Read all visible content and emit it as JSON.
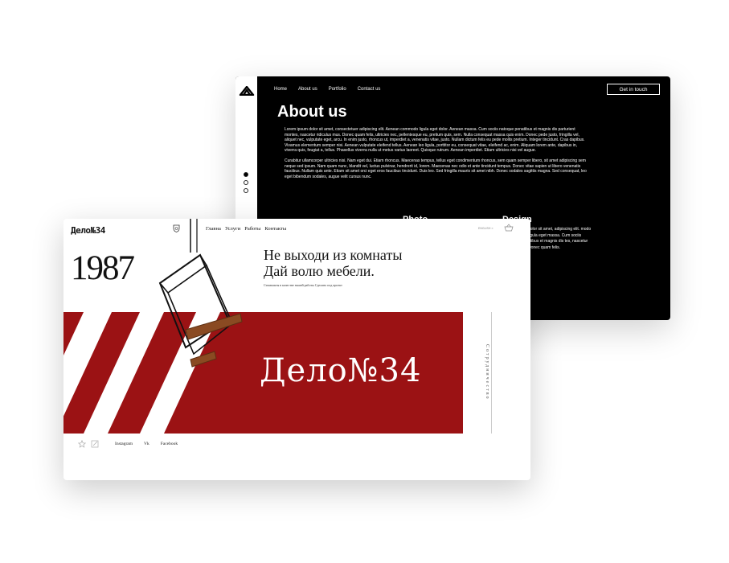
{
  "back_site": {
    "nav": [
      "Home",
      "About us",
      "Portfolio",
      "Contact us"
    ],
    "cta": "Get in touch",
    "title": "About us",
    "paragraphs": [
      "Lorem ipsum dolor sit amet, consectetuer adipiscing elit. Aenean commodo ligula eget dolor. Aenean massa. Cum sociis natoque penatibus et magnis dis parturient montes, nascetur ridiculus mus. Donec quam felis, ultricies nec, pellentesque eu, pretium quis, sem. Nulla consequat massa quis enim. Donec pede justo, fringilla vel, aliquet nec, vulputate eget, arcu. In enim justo, rhoncus ut, imperdiet a, venenatis vitae, justo. Nullam dictum felis eu pede mollis pretium. Integer tincidunt. Cras dapibus. Vivamus elementum semper nisi. Aenean vulputate eleifend tellus. Aenean leo ligula, porttitor eu, consequat vitae, eleifend ac, enim. Aliquam lorem ante, dapibus in, viverra quis, feugiat a, tellus. Phasellus viverra nulla ut metus varius laoreet. Quisque rutrum. Aenean imperdiet. Etiam ultricies nisi vel augue.",
      "Curabitur ullamcorper ultricies nisi. Nam eget dui. Etiam rhoncus. Maecenas tempus, tellus eget condimentum rhoncus, sem quam semper libero, sit amet adipiscing sem neque sed ipsum. Nam quam nunc, blandit vel, luctus pulvinar, hendrerit id, lorem. Maecenas nec odio et ante tincidunt tempus. Donec vitae sapien ut libero venenatis faucibus. Nullam quis ante. Etiam sit amet orci eget eros faucibus tincidunt. Duis leo. Sed fringilla mauris sit amet nibh. Donec sodales sagittis magna. Sed consequat, leo eget bibendum sodales, augue velit cursus nunc."
    ],
    "col_photo": "Photo",
    "col_design": "Design",
    "col_design_text": "dolor sit amet, adipiscing elit. modo ligula eget massa. Cum sociis ntibus et magnis dis tes, nascetur Donec quam felis."
  },
  "front_site": {
    "brand": "Дело№34",
    "nav": [
      "Главна",
      "Услуги",
      "Работы",
      "Контакты"
    ],
    "lang": "ENGLISH ≡",
    "year": "1987",
    "headline_1": "Не выходи из комнаты",
    "headline_2": "Дай волю мебели.",
    "subline": "Стимпакты в качестве нашей работы Сделано под проект",
    "big_brand": "Дело№34",
    "vertical": "Сотрудничество",
    "social": [
      "Instagram",
      "Vk",
      "Facebook"
    ]
  },
  "colors": {
    "accent_red": "#9b1214",
    "dark": "#000000"
  }
}
